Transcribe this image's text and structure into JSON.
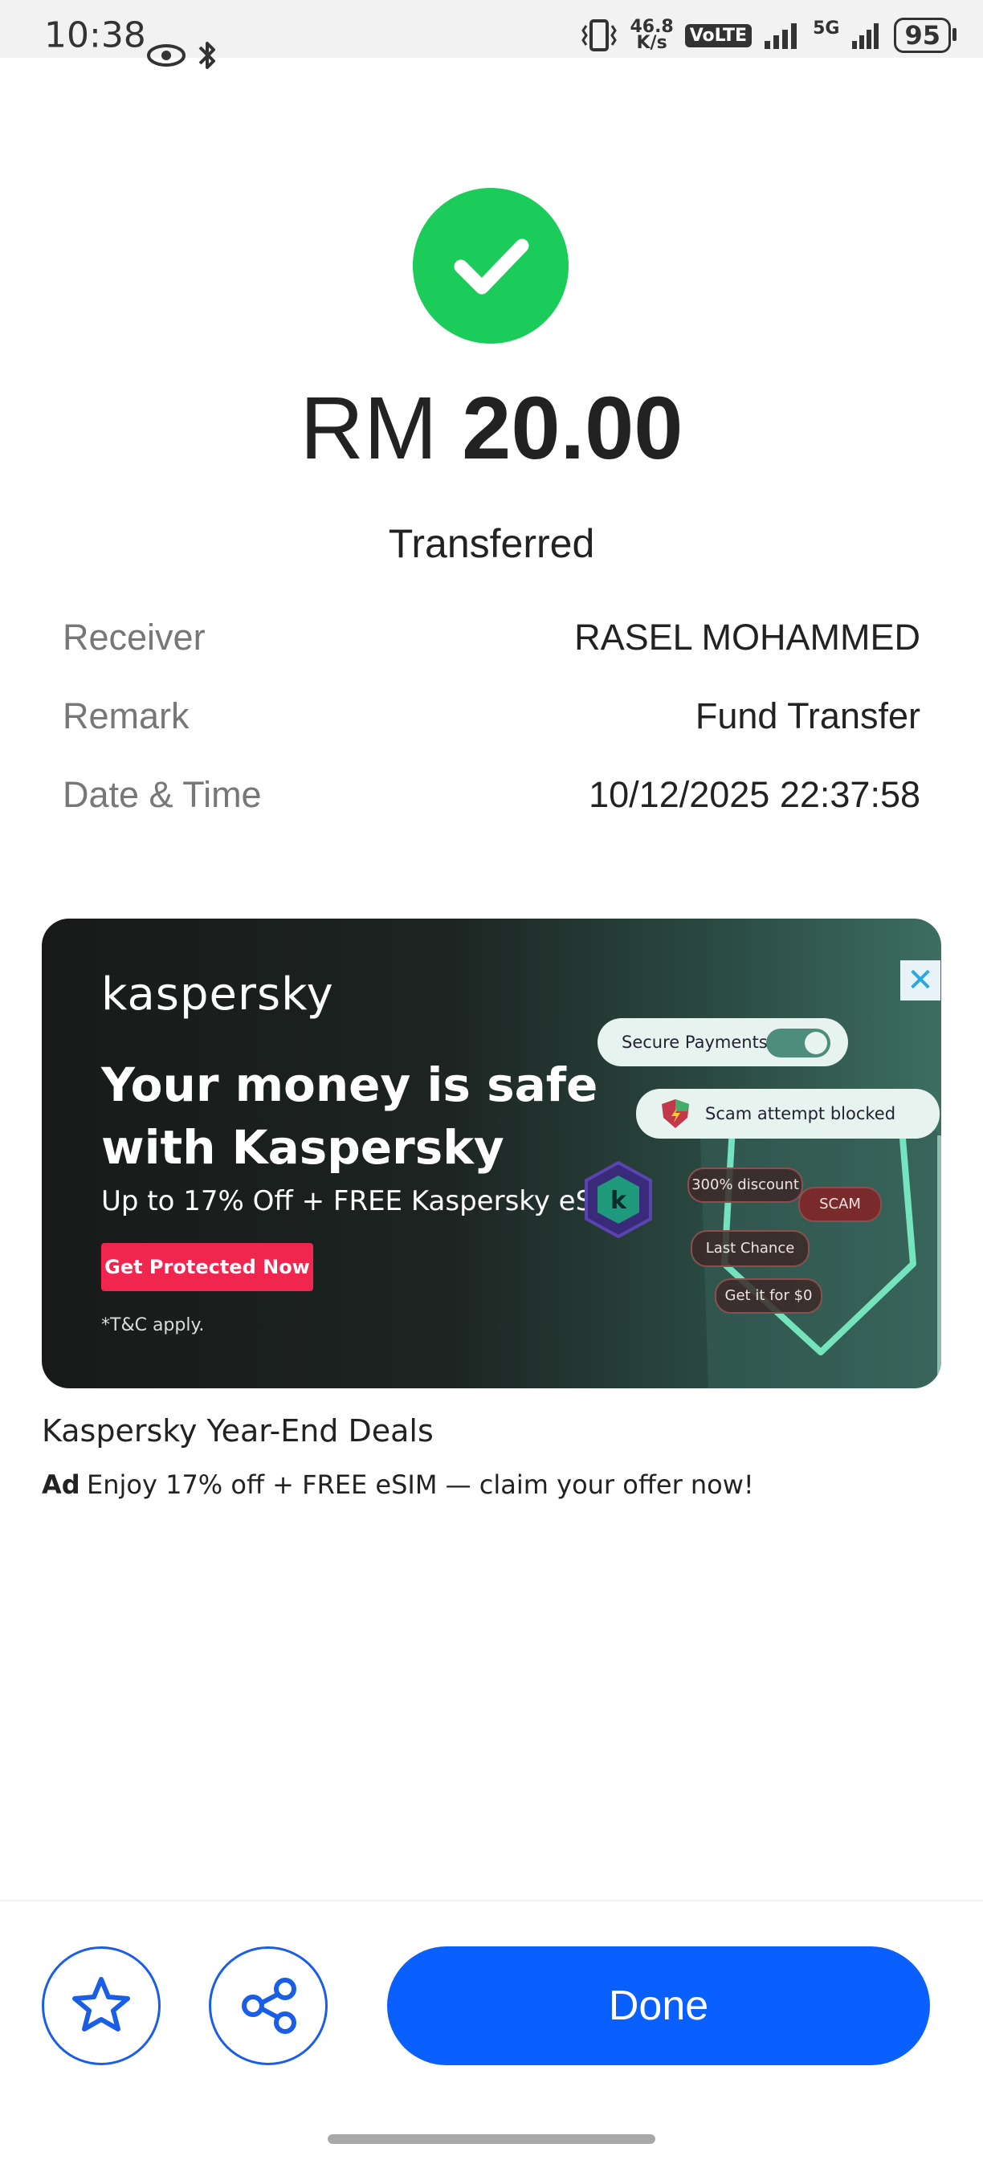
{
  "status_bar": {
    "time": "10:38",
    "speed_value": "46.8",
    "speed_unit": "K/s",
    "volte": "VoLTE",
    "network": "5G",
    "battery": "95"
  },
  "transaction": {
    "currency": "RM",
    "amount": "20.00",
    "status": "Transferred",
    "details": [
      {
        "label": "Receiver",
        "value": "RASEL MOHAMMED"
      },
      {
        "label": "Remark",
        "value": "Fund Transfer"
      },
      {
        "label": "Date & Time",
        "value": "10/12/2025 22:37:58"
      }
    ]
  },
  "ad": {
    "brand": "kaspersky",
    "headline": "Your money is safe with Kaspersky",
    "subline": "Up to 17% Off + FREE Kaspersky eSim",
    "cta": "Get Protected Now",
    "terms": "*T&C apply.",
    "secure_payments": "Secure Payments",
    "scam_blocked": "Scam attempt blocked",
    "chip_discount": "300% discount",
    "chip_scam": "SCAM",
    "chip_last": "Last Chance",
    "chip_free": "Get it for $0",
    "badge_letter": "k",
    "close": "✕",
    "title": "Kaspersky Year-End Deals",
    "label": "Ad",
    "description": "Enjoy 17% off + FREE eSIM — claim your offer now!"
  },
  "actions": {
    "done": "Done",
    "favorite_icon": "star-icon",
    "share_icon": "share-icon"
  },
  "colors": {
    "success": "#1ccc5b",
    "primary": "#0a60ff",
    "cta_red": "#f0264e"
  }
}
